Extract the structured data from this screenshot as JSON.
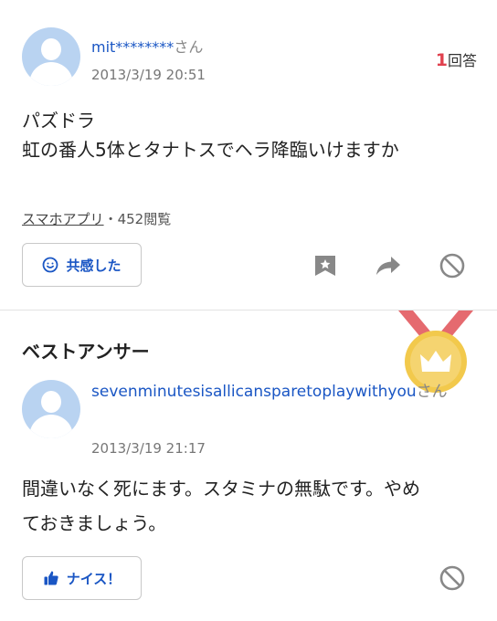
{
  "question": {
    "username": "mit********",
    "honorific": "さん",
    "date": "2013/3/19 20:51",
    "answer_count": "1",
    "answer_label": "回答",
    "lines": [
      "パズドラ",
      "虹の番人5体とタナトスでヘラ降臨いけますか"
    ],
    "category": "スマホアプリ",
    "views": "・452閲覧",
    "empathy_label": "共感した"
  },
  "best_answer": {
    "title": "ベストアンサー",
    "username": "sevenminutesisallicansparetoplaywithyou",
    "honorific": "さん",
    "date": "2013/3/19 21:17",
    "lines": [
      "間違いなく死にます。スタミナの無駄です。やめ",
      "ておきましょう。"
    ],
    "nice_label": "ナイス！"
  },
  "colors": {
    "link_blue": "#1a56c4",
    "accent_red": "#e0414e",
    "medal_gold": "#f2c94c",
    "ribbon_red": "#e56a6f"
  },
  "icons": [
    "avatar",
    "smile-icon",
    "bookmark-icon",
    "share-icon",
    "block-icon",
    "medal-icon",
    "thumbs-up-icon"
  ]
}
